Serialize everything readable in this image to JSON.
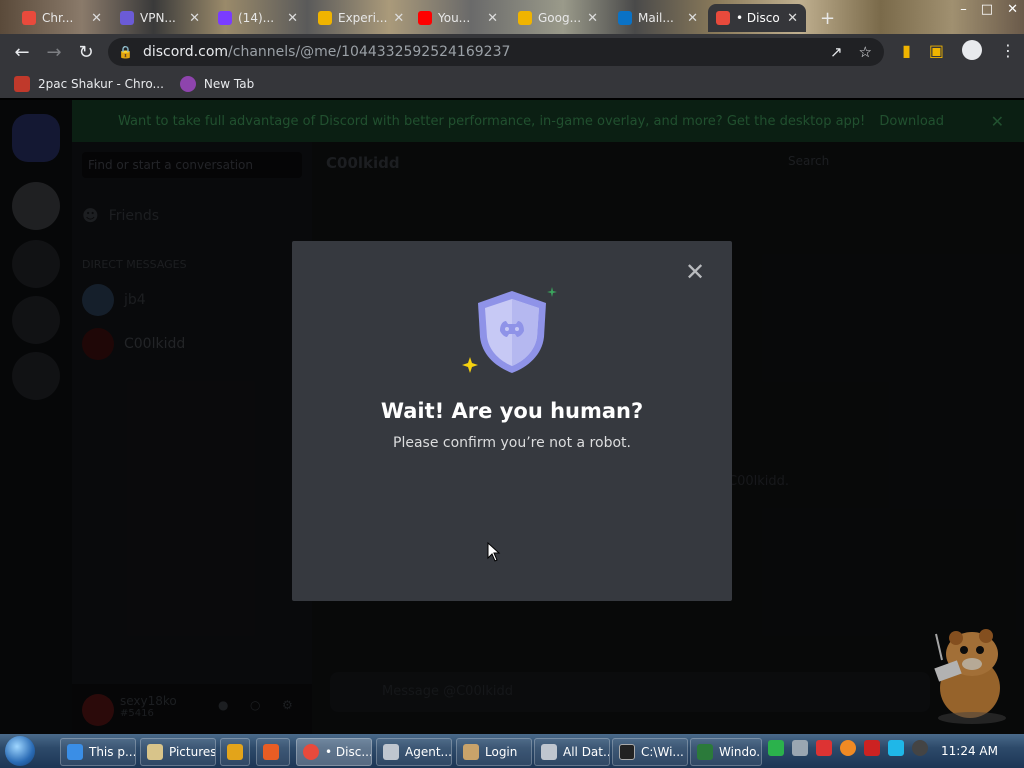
{
  "browser": {
    "tabs": [
      {
        "label": "Chr...",
        "color": "#e84a3c"
      },
      {
        "label": "VPN...",
        "color": "#6b5bd6"
      },
      {
        "label": "(14)...",
        "color": "#7a3cff"
      },
      {
        "label": "Experi...",
        "color": "#f0b400"
      },
      {
        "label": "You...",
        "color": "#ff0000"
      },
      {
        "label": "Goog...",
        "color": "#f0b400"
      },
      {
        "label": "Mail...",
        "color": "#0a72c6"
      },
      {
        "label": "• Disco",
        "color": "#e84a3c"
      }
    ],
    "new_tab": "+",
    "url_host": "discord.com",
    "url_path": "/channels/@me/1044332592524169237",
    "bookmarks": [
      {
        "label": "2pac Shakur - Chro...",
        "color": "#c0392b"
      },
      {
        "label": "New Tab",
        "color": "#8e44ad"
      }
    ]
  },
  "discord": {
    "banner_text": "Want to take full advantage of Discord with better performance, in-game overlay, and more? Get the desktop app!",
    "banner_download": "Download",
    "search_placeholder": "Find or start a conversation",
    "friends_label": "Friends",
    "direct_messages_label": "DIRECT MESSAGES",
    "dm_items": [
      "jb4",
      "C00lkidd"
    ],
    "chat_title": "C00lkidd",
    "chat_search_placeholder": "Search",
    "user_name": "sexy18ko",
    "user_tag": "#5416",
    "message_placeholder": "Message @C00lkidd",
    "background_fragment": "C00lkidd."
  },
  "modal": {
    "title": "Wait! Are you human?",
    "subtitle": "Please confirm you’re not a robot.",
    "close_icon": "close-icon",
    "accent": "#8f93e8"
  },
  "taskbar": {
    "items": [
      {
        "label": "This p..."
      },
      {
        "label": "Pictures"
      },
      {
        "label": ""
      },
      {
        "label": ""
      },
      {
        "label": "• Disc..."
      },
      {
        "label": "Agent..."
      },
      {
        "label": "Login"
      },
      {
        "label": "All Dat..."
      },
      {
        "label": "C:\\Wi..."
      },
      {
        "label": "Windo..."
      }
    ],
    "clock": "11:24 AM"
  }
}
